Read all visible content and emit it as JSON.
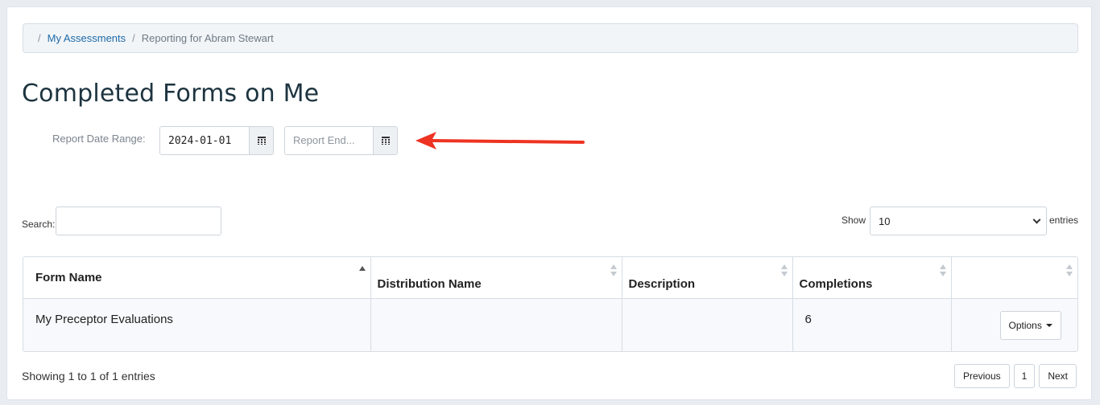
{
  "breadcrumb": {
    "link": "My Assessments",
    "current": "Reporting for Abram Stewart"
  },
  "title": "Completed Forms on Me",
  "date_range": {
    "label": "Report Date Range:",
    "start_value": "2024-01-01",
    "end_placeholder": "Report End..."
  },
  "search": {
    "label": "Search:",
    "value": ""
  },
  "length": {
    "show_label": "Show",
    "selected": "10",
    "entries_label": "entries"
  },
  "table": {
    "headers": [
      "Form Name",
      "Distribution Name",
      "Description",
      "Completions",
      ""
    ],
    "rows": [
      {
        "form_name": "My Preceptor Evaluations",
        "distribution": "",
        "description": "",
        "completions": "6",
        "options_label": "Options"
      }
    ]
  },
  "info": "Showing 1 to 1 of 1 entries",
  "pagination": {
    "previous": "Previous",
    "page": "1",
    "next": "Next"
  },
  "icons": {
    "calendar": "calendar-icon",
    "sort": "sort-icon",
    "caret": "caret-down-icon",
    "arrow": "red-annotation-arrow"
  },
  "colors": {
    "link": "#1e6aa8",
    "title": "#1d3440",
    "annotation_arrow": "#ee3322"
  }
}
